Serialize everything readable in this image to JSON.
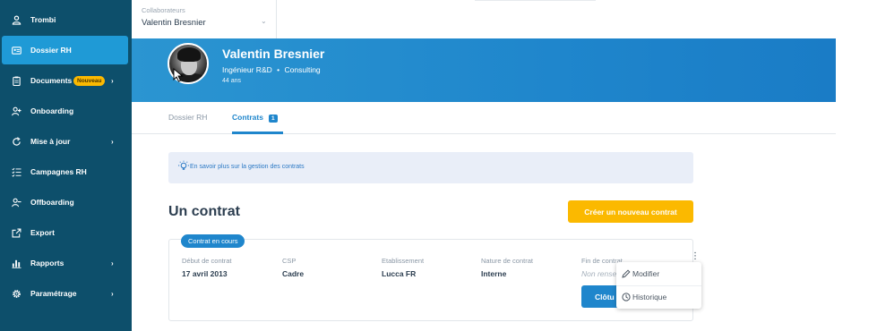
{
  "sidebar": {
    "items": [
      {
        "label": "Trombi",
        "icon": "person-icon"
      },
      {
        "label": "Dossier RH",
        "icon": "id-card-icon",
        "active": true
      },
      {
        "label": "Documents",
        "icon": "clipboard-icon",
        "badge": "Nouveau",
        "chevron": "›"
      },
      {
        "label": "Onboarding",
        "icon": "person-add-icon"
      },
      {
        "label": "Mise à jour",
        "icon": "refresh-icon",
        "chevron": "›"
      },
      {
        "label": "Campagnes RH",
        "icon": "checklist-icon"
      },
      {
        "label": "Offboarding",
        "icon": "person-remove-icon"
      },
      {
        "label": "Export",
        "icon": "export-icon"
      },
      {
        "label": "Rapports",
        "icon": "bar-chart-icon",
        "chevron": "›"
      },
      {
        "label": "Paramétrage",
        "icon": "gear-icon",
        "chevron": "›"
      }
    ]
  },
  "collaborator_select": {
    "label": "Collaborateurs",
    "value": "Valentin Bresnier",
    "chevron": "⌄"
  },
  "profile": {
    "name": "Valentin Bresnier",
    "role": "Ingénieur R&D",
    "separator": "•",
    "department": "Consulting",
    "age": "44 ans"
  },
  "tabs": [
    {
      "label": "Dossier RH",
      "active": false
    },
    {
      "label": "Contrats",
      "active": true,
      "count": "1"
    }
  ],
  "info_box": {
    "text": "En savoir plus sur la gestion des contrats",
    "icon": "lightbulb-icon"
  },
  "section": {
    "title": "Un contrat",
    "new_button": "Créer un nouveau contrat"
  },
  "contract": {
    "status": "Contrat en cours",
    "columns": [
      {
        "label": "Début de contrat",
        "value": "17 avril 2013"
      },
      {
        "label": "CSP",
        "value": "Cadre"
      },
      {
        "label": "Etablissement",
        "value": "Lucca FR"
      },
      {
        "label": "Nature de contrat",
        "value": "Interne"
      },
      {
        "label": "Fin de contrat",
        "value": "Non rense"
      }
    ],
    "close_button": "Clôtu",
    "more_icon": "⋮"
  },
  "context_menu": {
    "items": [
      {
        "label": "Modifier",
        "icon": "pencil-icon"
      },
      {
        "label": "Historique",
        "icon": "clock-icon"
      }
    ]
  },
  "colors": {
    "sidebar_bg": "#0d4f6b",
    "sidebar_active": "#1f9ad6",
    "banner": "#1f86cc",
    "accent_yellow": "#fbb900",
    "primary_blue": "#1f86cc"
  }
}
